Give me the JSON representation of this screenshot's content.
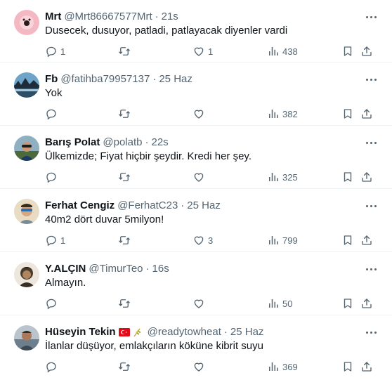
{
  "tweets": [
    {
      "name": "Mrt",
      "handle": "@Mrt86667577Mrt",
      "separator": "·",
      "time": "21s",
      "text": "Dusecek, dusuyor, patladi, patlayacak diyenler vardi",
      "replies": "1",
      "retweets": "",
      "likes": "1",
      "views": "438",
      "avatar_color": "#f4b8c2"
    },
    {
      "name": "Fb",
      "handle": "@fatihba79957137",
      "separator": "·",
      "time": "25 Haz",
      "text": "Yok",
      "replies": "",
      "retweets": "",
      "likes": "",
      "views": "382",
      "avatar_color": "#3b6f99"
    },
    {
      "name": "Barış Polat",
      "handle": "@polatb",
      "separator": "·",
      "time": "22s",
      "text": "Ülkemizde; Fiyat hiçbir şeydir. Kredi her şey.",
      "replies": "",
      "retweets": "",
      "likes": "",
      "views": "325",
      "avatar_color": "#6a8a9c"
    },
    {
      "name": "Ferhat Cengiz",
      "handle": "@FerhatC23",
      "separator": "·",
      "time": "25 Haz",
      "text": "40m2  dört duvar 5milyon!",
      "replies": "1",
      "retweets": "",
      "likes": "3",
      "views": "799",
      "avatar_color": "#d9c7a3"
    },
    {
      "name": "Y.ALÇIN",
      "handle": "@TimurTeo",
      "separator": "·",
      "time": "16s",
      "text": "Almayın.",
      "replies": "",
      "retweets": "",
      "likes": "",
      "views": "50",
      "avatar_color": "#5a4a3a"
    },
    {
      "name": "Hüseyin Tekin",
      "handle": "@readytowheat",
      "separator": "·",
      "time": "25 Haz",
      "text": "İlanlar düşüyor, emlakçıların köküne kibrit suyu",
      "replies": "",
      "retweets": "",
      "likes": "",
      "views": "369",
      "avatar_color": "#8c9aa5",
      "badges": [
        "turkey-flag-icon",
        "wheat-icon"
      ]
    }
  ],
  "colors": {
    "text_primary": "#0f1419",
    "text_secondary": "#536471",
    "divider": "#eff3f4",
    "flag_red": "#e30a17"
  }
}
